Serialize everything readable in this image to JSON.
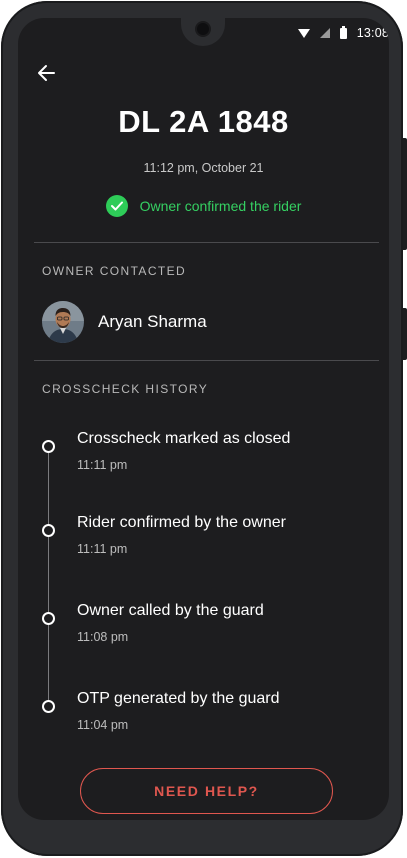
{
  "status_bar": {
    "time": "13:08",
    "icons": [
      "wifi-icon",
      "signal-icon",
      "battery-icon"
    ]
  },
  "header": {
    "back_icon": "arrow-left-icon"
  },
  "vehicle": {
    "plate": "DL 2A 1848",
    "datetime": "11:12 pm, October 21",
    "status_text": "Owner confirmed the rider",
    "status_icon": "check-circle-icon"
  },
  "owner_section": {
    "title": "OWNER CONTACTED",
    "name": "Aryan Sharma"
  },
  "history_section": {
    "title": "CROSSCHECK HISTORY",
    "items": [
      {
        "title": "Crosscheck marked as closed",
        "time": "11:11 pm"
      },
      {
        "title": "Rider confirmed by the owner",
        "time": "11:11 pm"
      },
      {
        "title": "Owner called by the guard",
        "time": "11:08 pm"
      },
      {
        "title": "OTP generated by the guard",
        "time": "11:04 pm"
      }
    ]
  },
  "help_button": {
    "label": "NEED HELP?"
  },
  "colors": {
    "background": "#1d1d1f",
    "success": "#35d062",
    "accent_red": "#e0574f",
    "text_primary": "#ffffff",
    "text_secondary": "#bdbdbd"
  }
}
